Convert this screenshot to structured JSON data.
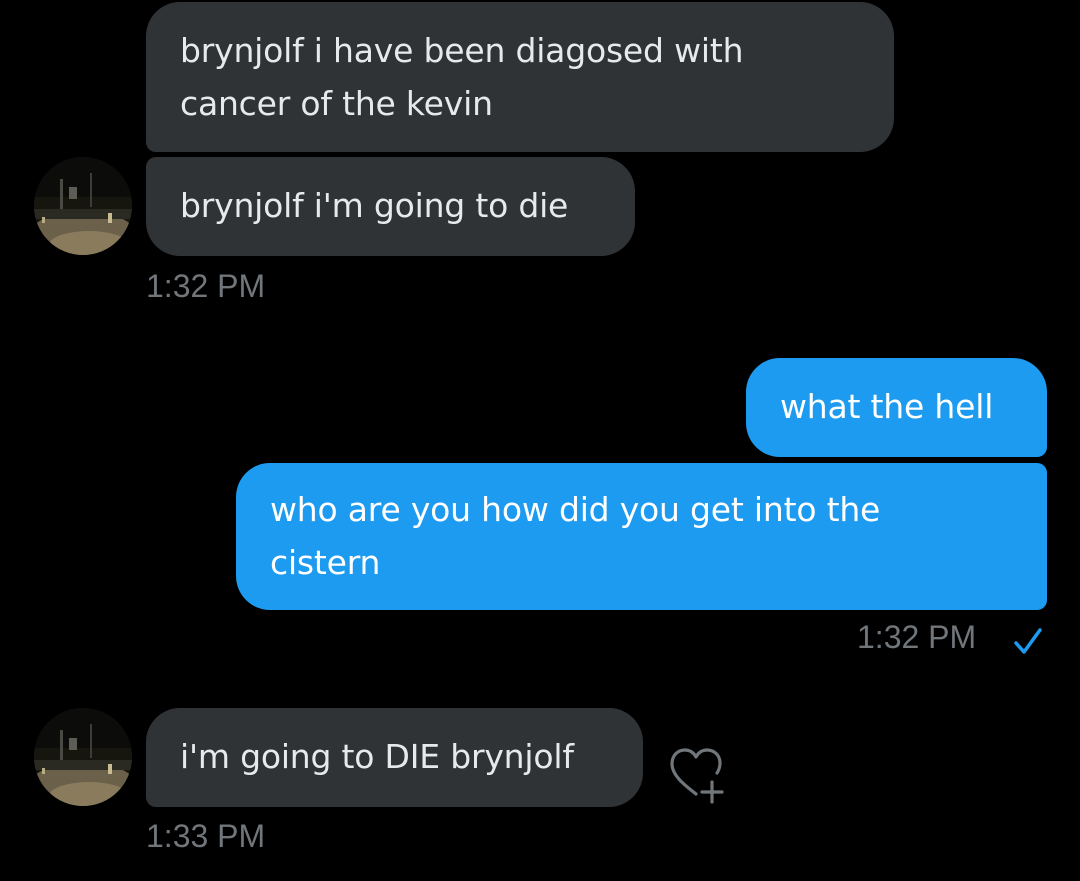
{
  "conversation": {
    "incoming_group_1": {
      "messages": [
        {
          "line1": "brynjolf i have been diagosed with",
          "line2": "cancer of the kevin"
        },
        {
          "text": "brynjolf i'm going to die"
        }
      ],
      "timestamp": "1:32 PM"
    },
    "outgoing_group": {
      "messages": [
        {
          "text": "what the hell"
        },
        {
          "line1": "who are you how did you get into the",
          "line2": "cistern"
        }
      ],
      "timestamp": "1:32 PM",
      "read_receipt_icon": "check-icon"
    },
    "incoming_group_2": {
      "messages": [
        {
          "text": "i'm going to DIE brynjolf"
        }
      ],
      "timestamp": "1:33 PM",
      "reaction_icon": "add-reaction-heart-icon"
    }
  },
  "colors": {
    "background": "#000000",
    "incoming_bubble": "#2f3336",
    "outgoing_bubble": "#1d9bf0",
    "timestamp": "#71767b",
    "check": "#1d9bf0"
  }
}
